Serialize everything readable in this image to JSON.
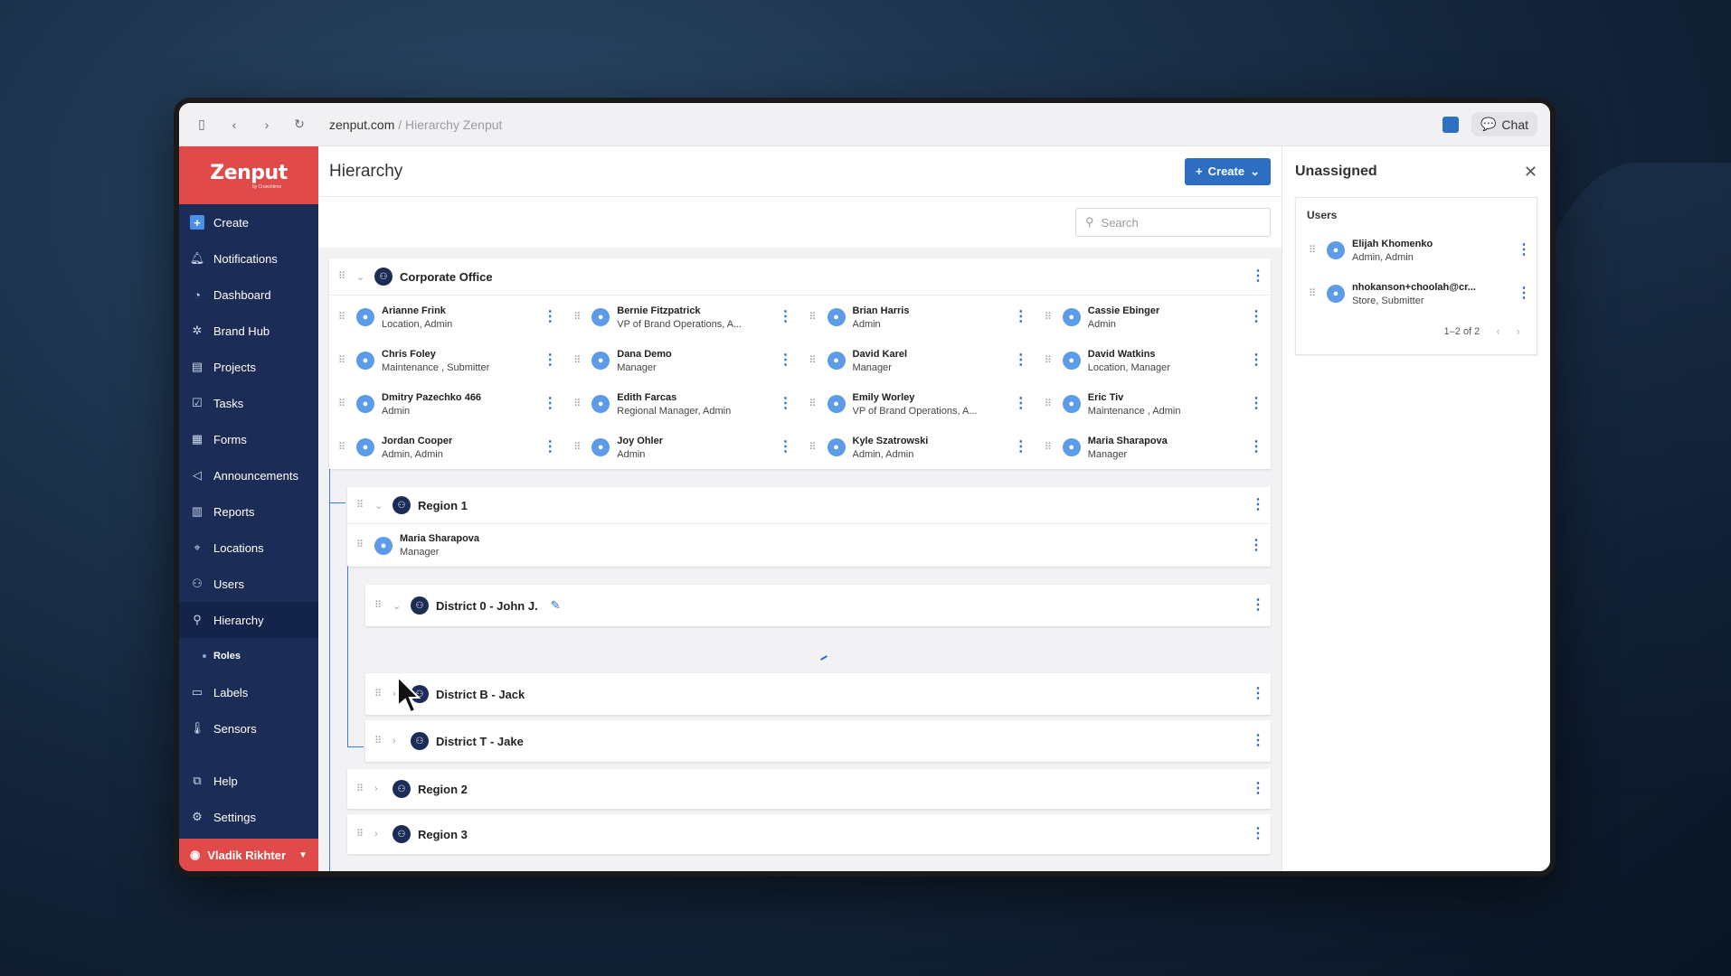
{
  "browser": {
    "url_domain": "zenput.com",
    "url_path": " / Hierarchy Zenput",
    "chat_label": "Chat"
  },
  "sidebar": {
    "logo_text": "Zenput",
    "logo_by": "by Crunchtime",
    "items": [
      {
        "label": "Create",
        "icon": "plus-icon"
      },
      {
        "label": "Notifications",
        "icon": "bell-icon"
      },
      {
        "label": "Dashboard",
        "icon": "gauge-icon"
      },
      {
        "label": "Brand Hub",
        "icon": "hub-icon"
      },
      {
        "label": "Projects",
        "icon": "projects-icon"
      },
      {
        "label": "Tasks",
        "icon": "checkbox-icon"
      },
      {
        "label": "Forms",
        "icon": "form-icon"
      },
      {
        "label": "Announcements",
        "icon": "megaphone-icon"
      },
      {
        "label": "Reports",
        "icon": "reports-icon"
      },
      {
        "label": "Locations",
        "icon": "pin-icon"
      },
      {
        "label": "Users",
        "icon": "users-icon"
      },
      {
        "label": "Hierarchy",
        "icon": "hierarchy-icon"
      }
    ],
    "sub_item": "Roles",
    "items_after": [
      {
        "label": "Labels",
        "icon": "label-icon"
      },
      {
        "label": "Sensors",
        "icon": "thermometer-icon"
      }
    ],
    "bottom_items": [
      {
        "label": "Help",
        "icon": "help-icon"
      },
      {
        "label": "Settings",
        "icon": "gear-icon"
      }
    ],
    "user_name": "Vladik Rikhter"
  },
  "main": {
    "title": "Hierarchy",
    "create_label": "Create",
    "search_placeholder": "Search",
    "corporate": {
      "name": "Corporate Office",
      "users": [
        {
          "name": "Arianne Frink",
          "role": "Location, Admin"
        },
        {
          "name": "Bernie Fitzpatrick",
          "role": "VP of Brand Operations, A..."
        },
        {
          "name": "Brian Harris",
          "role": "Admin"
        },
        {
          "name": "Cassie Ebinger",
          "role": "Admin"
        },
        {
          "name": "Chris Foley",
          "role": "Maintenance , Submitter"
        },
        {
          "name": "Dana Demo",
          "role": "Manager"
        },
        {
          "name": "David Karel",
          "role": "Manager"
        },
        {
          "name": "David Watkins",
          "role": "Location, Manager"
        },
        {
          "name": "Dmitry Pazechko 466",
          "role": "Admin"
        },
        {
          "name": "Edith Farcas",
          "role": "Regional Manager, Admin"
        },
        {
          "name": "Emily Worley",
          "role": "VP of Brand Operations, A..."
        },
        {
          "name": "Eric Tiv",
          "role": "Maintenance , Admin"
        },
        {
          "name": "Jordan Cooper",
          "role": "Admin, Admin"
        },
        {
          "name": "Joy Ohler",
          "role": "Admin"
        },
        {
          "name": "Kyle Szatrowski",
          "role": "Admin, Admin"
        },
        {
          "name": "Maria Sharapova",
          "role": "Manager"
        }
      ]
    },
    "region1": {
      "name": "Region 1",
      "user": {
        "name": "Maria Sharapova",
        "role": "Manager"
      }
    },
    "district0": "District 0 - John J.",
    "districtB": "District B - Jack",
    "districtT": "District T - Jake",
    "region2": "Region 2",
    "region3": "Region 3"
  },
  "unassigned": {
    "title": "Unassigned",
    "section": "Users",
    "users": [
      {
        "name": "Elijah Khomenko",
        "role": "Admin, Admin"
      },
      {
        "name": "nhokanson+choolah@cr...",
        "role": "Store, Submitter"
      }
    ],
    "pager": "1–2 of 2"
  }
}
